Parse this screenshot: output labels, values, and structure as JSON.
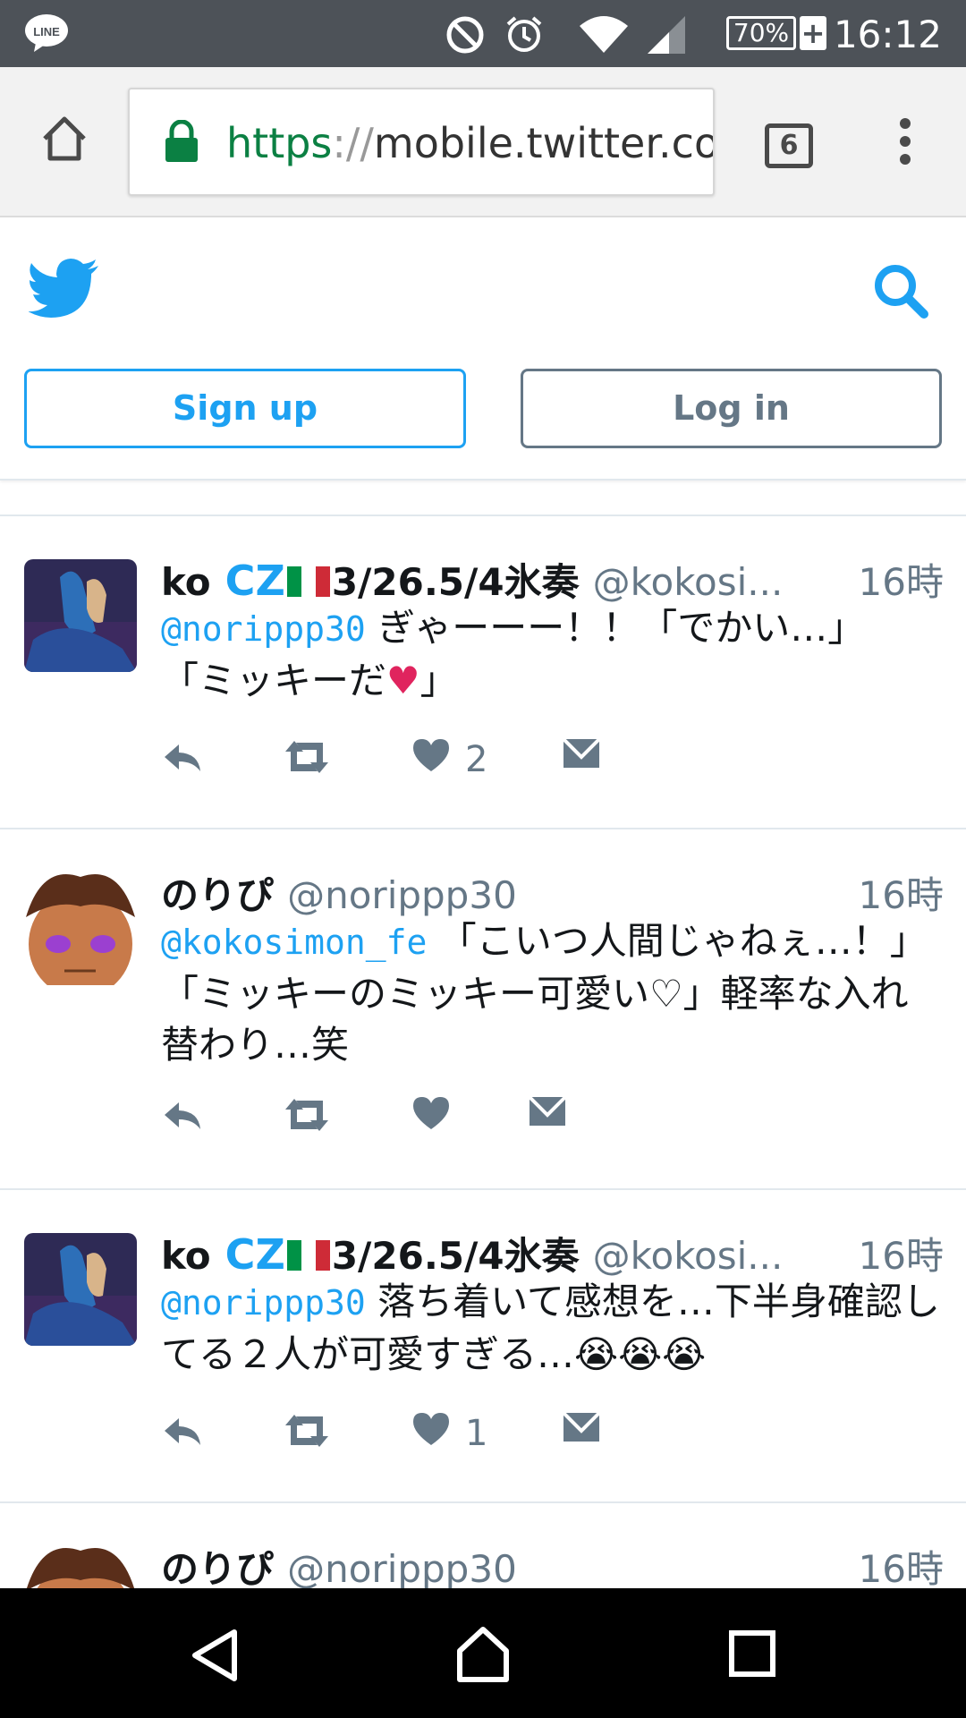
{
  "status_bar": {
    "time": "16:12",
    "battery": "70%",
    "line_app_label": "LINE"
  },
  "browser": {
    "url_scheme": "https",
    "url_sep": "://",
    "url_rest": "mobile.twitter.com",
    "tabs_count": "6"
  },
  "header": {
    "signup_label": "Sign up",
    "login_label": "Log in",
    "brand_color": "#1da1f2"
  },
  "tweets": [
    {
      "name_prefix": "ko",
      "name_suffix": "3/26.5/4氷奏",
      "handle": "@kokosi...",
      "time": "16時",
      "mention": "@norippp30",
      "text_1": " ぎゃーーー！！「でかい…」",
      "text_2": "「ミッキーだ",
      "text_3": "」",
      "likes": "2"
    },
    {
      "name": "のりぴ",
      "handle": "@norippp30",
      "time": "16時",
      "mention": "@kokosimon_fe",
      "text": " 「こいつ人間じゃねぇ…！」「ミッキーのミッキー可愛い♡」軽率な入れ替わり…笑",
      "likes": ""
    },
    {
      "name_prefix": "ko",
      "name_suffix": "3/26.5/4氷奏",
      "handle": "@kokosi...",
      "time": "16時",
      "mention": "@norippp30",
      "text": " 落ち着いて感想を…下半身確認してる２人が可愛すぎる…😭😭😭",
      "likes": "1"
    },
    {
      "name": "のりぴ",
      "handle": "@norippp30",
      "time": "16時"
    }
  ]
}
